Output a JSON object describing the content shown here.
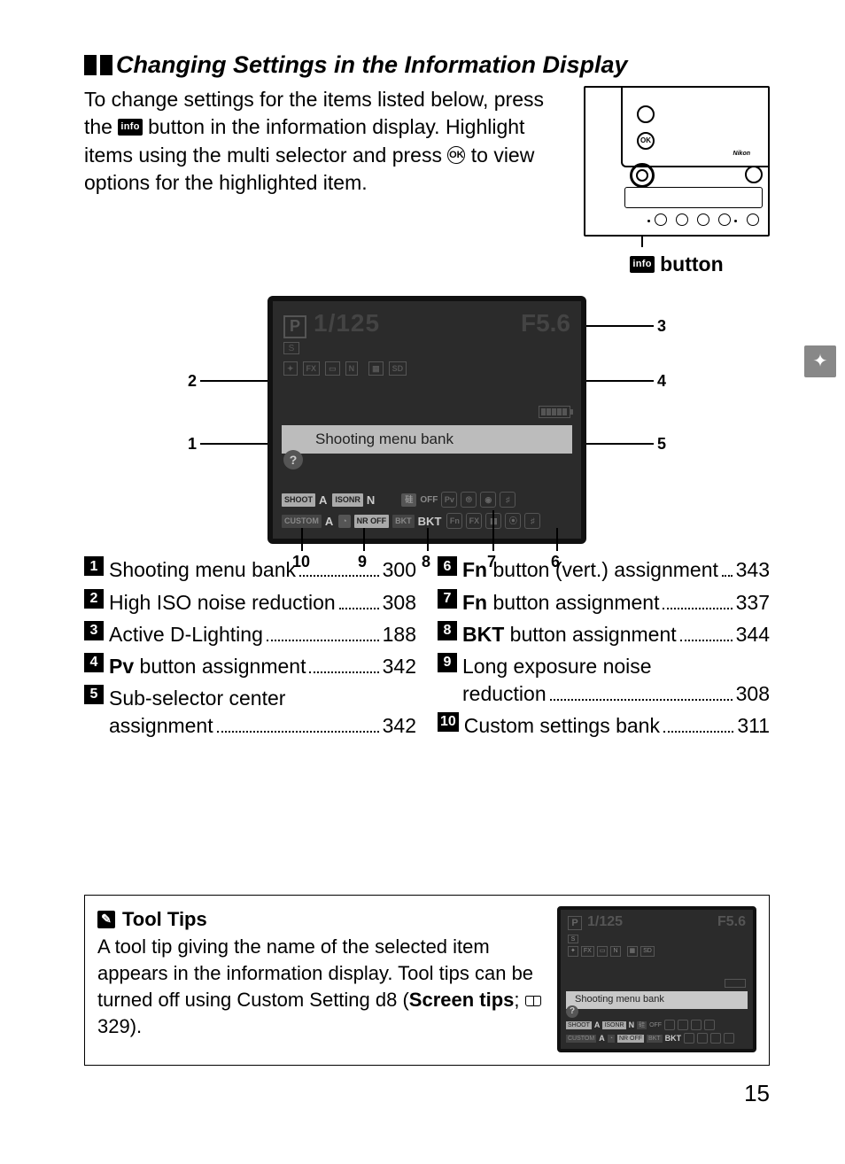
{
  "heading": "Changing Settings in the Information Display",
  "intro": {
    "line1": "To change settings for the items listed below, press the ",
    "line2": " button in the information display.  Highlight items using the multi selector and press ",
    "line3": " to view options for the highlighted item."
  },
  "info_icon_text": "info",
  "ok_icon_text": "OK",
  "camera_caption": " button",
  "screen": {
    "mode": "P",
    "shutter": "1/125",
    "aperture": "F5.6",
    "s_mark": "S",
    "chips": [
      "FX",
      "N",
      "SD"
    ],
    "tooltip": "Shooting menu bank",
    "q": "?",
    "shoot": "SHOOT",
    "custom": "CUSTOM",
    "A": "A",
    "isonr": "ISONR",
    "N": "N",
    "nroff": "NR OFF",
    "bktOff": "OFF",
    "bkt_tag": "BKT",
    "BKT": "BKT",
    "pv": "Pv",
    "fn": "Fn"
  },
  "callouts": {
    "c1": "1",
    "c2": "2",
    "c3": "3",
    "c4": "4",
    "c5": "5",
    "c6": "6",
    "c7": "7",
    "c8": "8",
    "c9": "9",
    "c10": "10"
  },
  "list_left": [
    {
      "n": "1",
      "label": "Shooting menu bank",
      "page": "300"
    },
    {
      "n": "2",
      "label": "High ISO noise reduction",
      "page": "308"
    },
    {
      "n": "3",
      "label": "Active D-Lighting",
      "page": "188"
    },
    {
      "n": "4",
      "bold": "Pv",
      "label": " button assignment",
      "page": "342"
    },
    {
      "n": "5",
      "label": "Sub-selector center assignment",
      "page": "342",
      "wrap": true
    }
  ],
  "list_right": [
    {
      "n": "6",
      "bold": "Fn",
      "label": " button (vert.) assignment",
      "page": "343"
    },
    {
      "n": "7",
      "bold": "Fn",
      "label": " button assignment",
      "page": "337"
    },
    {
      "n": "8",
      "bold": "BKT",
      "label": " button assignment",
      "page": "344"
    },
    {
      "n": "9",
      "label": "Long exposure noise reduction",
      "page": "308",
      "wrap": true
    },
    {
      "n": "10",
      "label": "Custom settings bank",
      "page": "311"
    }
  ],
  "tip": {
    "title": "Tool Tips",
    "body1": "A tool tip giving the name of the selected item appears in the information display.  Tool tips can be turned off using Custom Setting d8 (",
    "bold": "Screen tips",
    "body2": "; ",
    "page": "329",
    "body3": ")."
  },
  "mini": {
    "tooltip": "Shooting menu bank"
  },
  "page_number": "15"
}
